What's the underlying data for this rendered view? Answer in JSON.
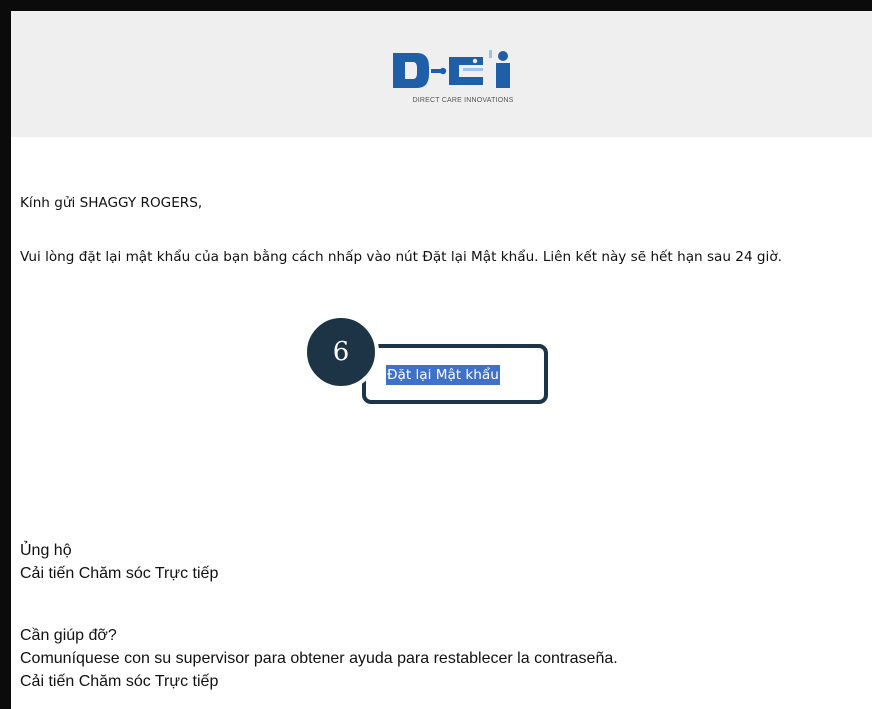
{
  "header": {
    "logo_icon": "dci-logo",
    "logo_caption": "DIRECT CARE INNOVATIONS",
    "colors": {
      "logo_blue": "#1f5fa8",
      "logo_light": "#9ec3e8"
    }
  },
  "email": {
    "greeting": "Kính gửi SHAGGY ROGERS,",
    "instructions": "Vui lòng đặt lại mật khẩu của bạn bằng cách nhấp vào nút Đặt lại Mật khẩu. Liên kết này sẽ hết hạn sau 24 giờ.",
    "reset_link_label": "Đặt lại Mật khẩu",
    "step_number": "6",
    "signoff_line1": "Ủng hộ",
    "signoff_line2": "Cải tiến Chăm sóc Trực tiếp",
    "help_title": "Cần giúp đỡ?",
    "help_text": "Comuníquese con su supervisor para obtener ayuda para restablecer la contraseña.",
    "help_signature": "Cải tiến Chăm sóc Trực tiếp"
  },
  "colors": {
    "frame_border": "#0b0b0b",
    "header_bg": "#efefef",
    "highlight_bg": "#3f72c6",
    "callout_navy": "#1d3447"
  }
}
